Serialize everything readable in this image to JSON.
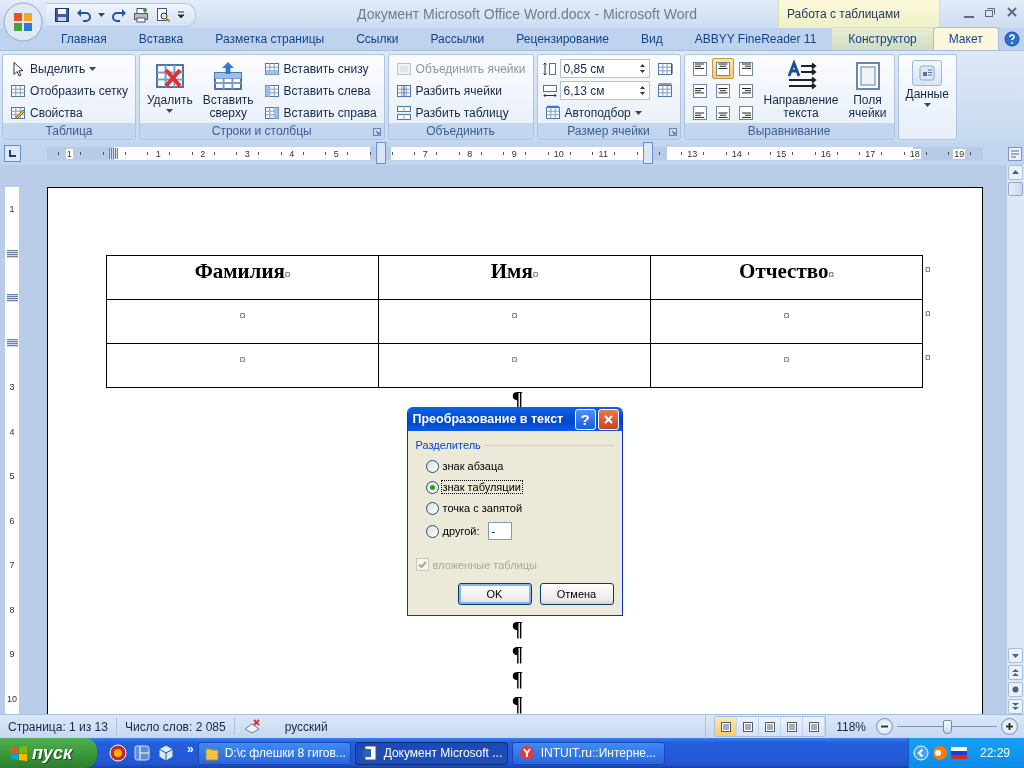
{
  "window": {
    "title": "Документ Microsoft Office Word.docx - Microsoft Word",
    "context_group": "Работа с таблицами"
  },
  "tabs": [
    {
      "label": "Главная",
      "selected": false,
      "contextual": false
    },
    {
      "label": "Вставка",
      "selected": false,
      "contextual": false
    },
    {
      "label": "Разметка страницы",
      "selected": false,
      "contextual": false
    },
    {
      "label": "Ссылки",
      "selected": false,
      "contextual": false
    },
    {
      "label": "Рассылки",
      "selected": false,
      "contextual": false
    },
    {
      "label": "Рецензирование",
      "selected": false,
      "contextual": false
    },
    {
      "label": "Вид",
      "selected": false,
      "contextual": false
    },
    {
      "label": "ABBYY FineReader 11",
      "selected": false,
      "contextual": false
    },
    {
      "label": "Конструктор",
      "selected": false,
      "contextual": true
    },
    {
      "label": "Макет",
      "selected": true,
      "contextual": true
    }
  ],
  "ribbon_groups": [
    {
      "title": "Таблица",
      "launcher": false,
      "columns": [
        [
          {
            "kind": "small",
            "label": "Выделить",
            "dropdown": true,
            "disabled": false
          },
          {
            "kind": "small",
            "label": "Отобразить сетку",
            "dropdown": false,
            "disabled": false
          },
          {
            "kind": "small",
            "label": "Свойства",
            "dropdown": false,
            "disabled": false
          }
        ]
      ]
    },
    {
      "title": "Строки и столбцы",
      "launcher": true,
      "columns": [
        [
          {
            "kind": "large",
            "label": "Удалить",
            "dropdown": true,
            "disabled": false
          }
        ],
        [
          {
            "kind": "large",
            "label": "Вставить сверху",
            "dropdown": false,
            "disabled": false
          }
        ],
        [
          {
            "kind": "small",
            "label": "Вставить снизу",
            "dropdown": false,
            "disabled": false
          },
          {
            "kind": "small",
            "label": "Вставить слева",
            "dropdown": false,
            "disabled": false
          },
          {
            "kind": "small",
            "label": "Вставить справа",
            "dropdown": false,
            "disabled": false
          }
        ]
      ]
    },
    {
      "title": "Объединить",
      "launcher": false,
      "columns": [
        [
          {
            "kind": "small",
            "label": "Объединить ячейки",
            "dropdown": false,
            "disabled": true
          },
          {
            "kind": "small",
            "label": "Разбить ячейки",
            "dropdown": false,
            "disabled": false
          },
          {
            "kind": "small",
            "label": "Разбить таблицу",
            "dropdown": false,
            "disabled": false
          }
        ]
      ]
    },
    {
      "title": "Размер ячейки",
      "launcher": true,
      "columns": [
        [
          {
            "kind": "spin",
            "value": "0,85 см"
          },
          {
            "kind": "spin",
            "value": "6,13 см"
          },
          {
            "kind": "small",
            "label": "Автоподбор",
            "dropdown": true,
            "disabled": false
          }
        ],
        [
          {
            "kind": "icon"
          },
          {
            "kind": "icon"
          }
        ]
      ]
    },
    {
      "title": "Выравнивание",
      "launcher": false,
      "columns": [
        [
          {
            "kind": "align-grid",
            "cells": [
              {
                "selected": false
              },
              {
                "selected": true
              },
              {
                "selected": false
              },
              {
                "selected": false
              },
              {
                "selected": false
              },
              {
                "selected": false
              },
              {
                "selected": false
              },
              {
                "selected": false
              },
              {
                "selected": false
              }
            ]
          }
        ],
        [
          {
            "kind": "large",
            "label": "Направление текста",
            "dropdown": false,
            "disabled": false
          }
        ],
        [
          {
            "kind": "large",
            "label": "Поля ячейки",
            "dropdown": false,
            "disabled": false
          }
        ]
      ]
    },
    {
      "columns": [
        [
          {
            "kind": "large",
            "label": "Данные",
            "dropdown": true,
            "disabled": false
          }
        ]
      ]
    }
  ],
  "ruler": {
    "items": [
      {
        "kind": "number",
        "label": "1"
      },
      {
        "kind": "margin"
      },
      {
        "kind": "number",
        "label": "1"
      },
      {
        "kind": "number",
        "label": "2"
      },
      {
        "kind": "number",
        "label": "3"
      },
      {
        "kind": "number",
        "label": "4"
      },
      {
        "kind": "number",
        "label": "5"
      },
      {
        "kind": "column"
      },
      {
        "kind": "number",
        "label": "7"
      },
      {
        "kind": "number",
        "label": "8"
      },
      {
        "kind": "number",
        "label": "9"
      },
      {
        "kind": "number",
        "label": "10"
      },
      {
        "kind": "number",
        "label": "11"
      },
      {
        "kind": "column"
      },
      {
        "kind": "number",
        "label": "13"
      },
      {
        "kind": "number",
        "label": "14"
      },
      {
        "kind": "number",
        "label": "15"
      },
      {
        "kind": "number",
        "label": "16"
      },
      {
        "kind": "number",
        "label": "17"
      },
      {
        "kind": "number",
        "label": "18"
      },
      {
        "kind": "number",
        "label": "19"
      }
    ]
  },
  "vertical_ruler": {
    "items": [
      {
        "kind": "number",
        "label": "1"
      },
      {
        "kind": "margin"
      },
      {
        "kind": "row"
      },
      {
        "kind": "row"
      },
      {
        "kind": "number",
        "label": "3"
      },
      {
        "kind": "number",
        "label": "4"
      },
      {
        "kind": "number",
        "label": "5"
      },
      {
        "kind": "number",
        "label": "6"
      },
      {
        "kind": "number",
        "label": "7"
      },
      {
        "kind": "number",
        "label": "8"
      },
      {
        "kind": "number",
        "label": "9"
      },
      {
        "kind": "number",
        "label": "10"
      }
    ]
  },
  "document": {
    "table": {
      "header": {
        "cells": [
          {
            "text": "Фамилия",
            "end_mark": "¤"
          },
          {
            "text": "Имя",
            "end_mark": "¤"
          },
          {
            "text": "Отчество",
            "end_mark": "¤"
          }
        ],
        "row_end": "¤"
      },
      "rows": [
        {
          "cells": [
            "¤",
            "¤",
            "¤"
          ],
          "row_end": "¤"
        },
        {
          "cells": [
            "¤",
            "¤",
            "¤"
          ],
          "row_end": "¤"
        }
      ]
    },
    "marks_before": [
      "¶"
    ],
    "marks_after": [
      "¶",
      "¶",
      "¶",
      "¶"
    ]
  },
  "dialog": {
    "title": "Преобразование в текст",
    "help": "?",
    "group_label": "Разделитель",
    "options": [
      {
        "kind": "radio",
        "label": "знак абзаца",
        "selected": false,
        "focused": false
      },
      {
        "kind": "radio",
        "label": "знак табуляции",
        "selected": true,
        "focused": true
      },
      {
        "kind": "radio",
        "label": "точка с запятой",
        "selected": false,
        "focused": false
      },
      {
        "kind": "radio-field",
        "label": "другой:",
        "selected": false,
        "focused": false
      }
    ],
    "other_field": {
      "value": "-"
    },
    "nested": {
      "label": "вложенные таблицы",
      "checked": true,
      "disabled": true
    },
    "buttons": [
      {
        "label": "OK",
        "default": true
      },
      {
        "label": "Отмена",
        "default": false
      }
    ]
  },
  "status_bar": {
    "page": "Страница: 1 из 13",
    "words": "Число слов: 2 085",
    "language": "русский",
    "views": [
      {
        "selected": true
      },
      {
        "selected": false
      },
      {
        "selected": false
      },
      {
        "selected": false
      },
      {
        "selected": false
      }
    ],
    "zoom": "118%",
    "zoom_slider": {
      "level": 0.5
    }
  },
  "taskbar": {
    "start": "пуск",
    "more": "»",
    "tasks": [
      {
        "label": "D:\\с флешки 8 гигов...",
        "selected": false
      },
      {
        "label": "Документ Microsoft ...",
        "selected": true
      },
      {
        "label": "INTUIT.ru::Интерне...",
        "selected": false
      }
    ],
    "clock": "22:29"
  }
}
